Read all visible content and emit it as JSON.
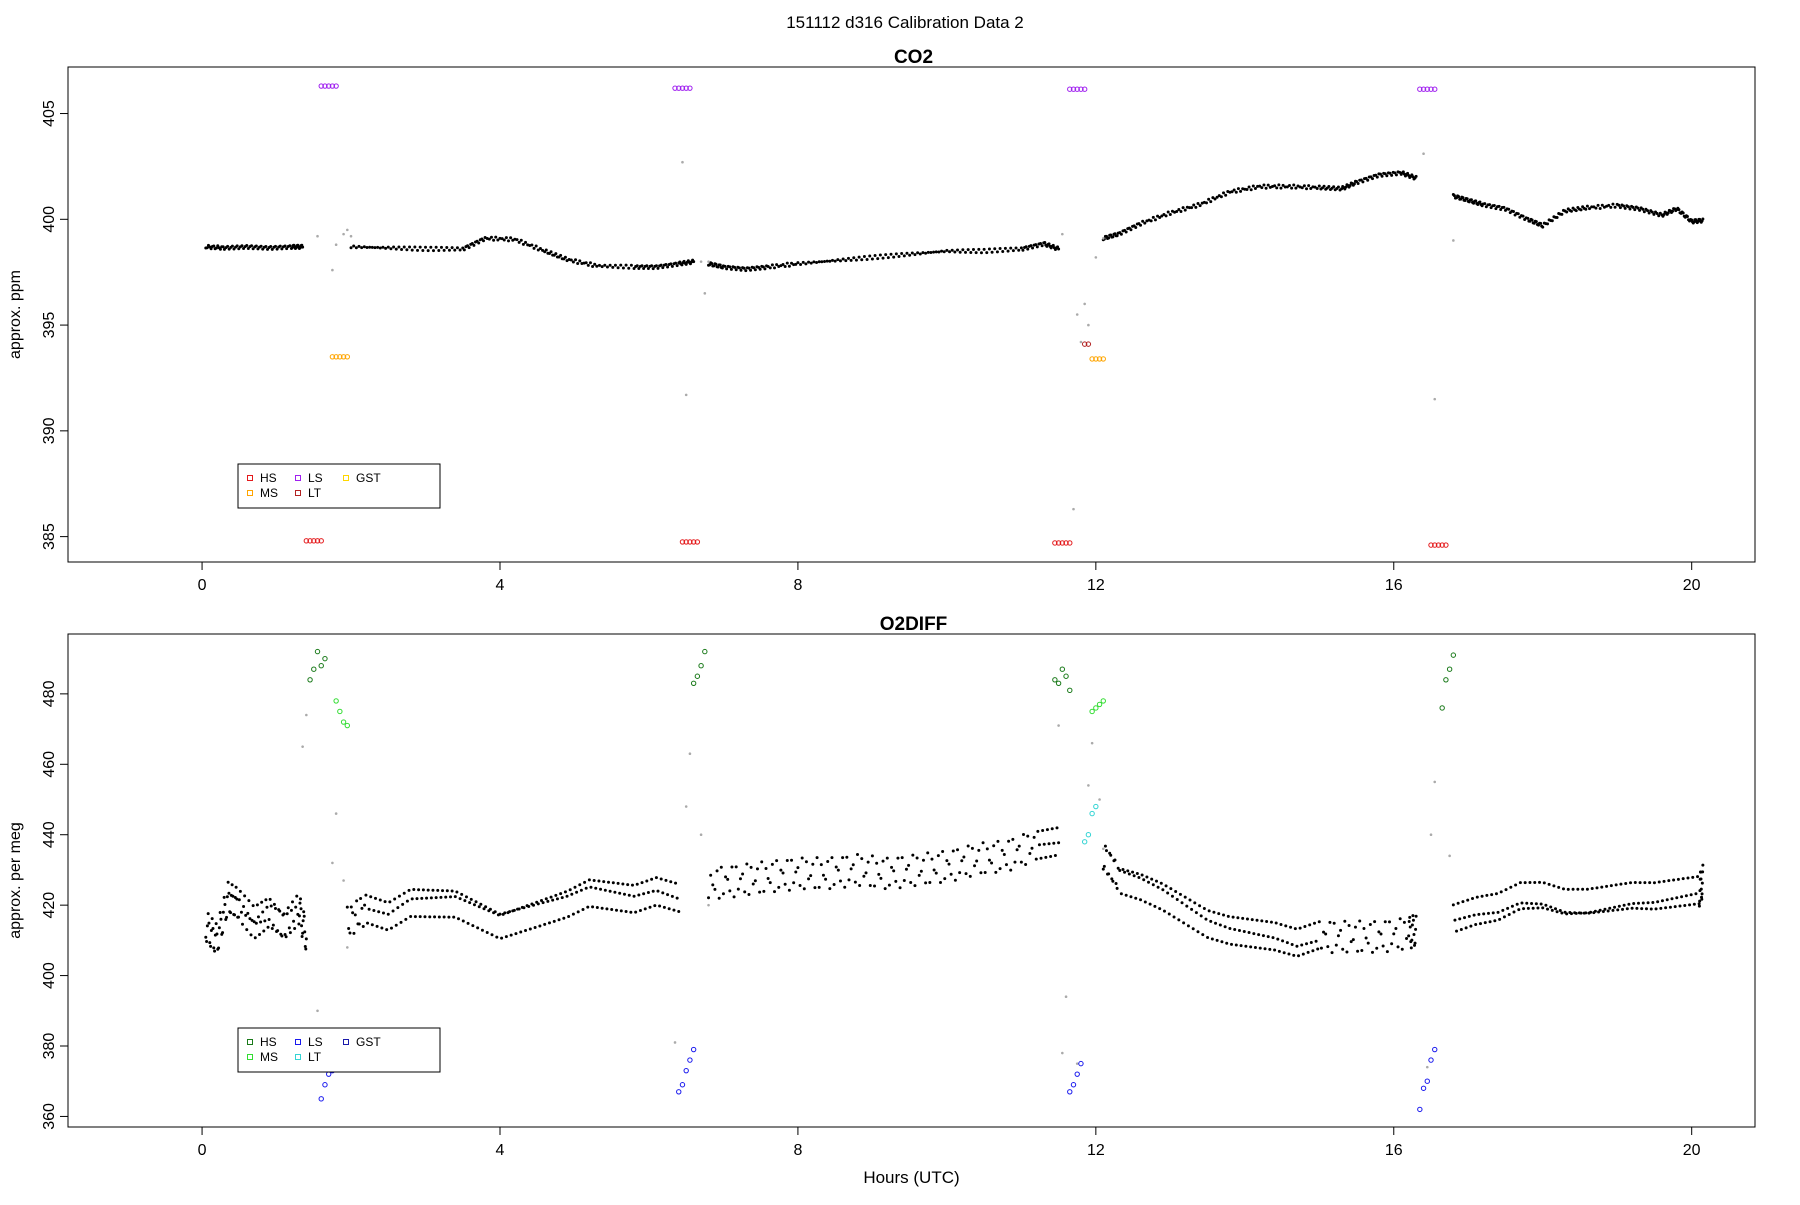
{
  "figure": {
    "title": "151112   d316   Calibration Data 2"
  },
  "chart_data": [
    {
      "type": "scatter",
      "title": "CO2",
      "xlabel": "",
      "ylabel": "approx. ppm",
      "xlim": [
        -1.8,
        20.85
      ],
      "ylim": [
        383.8,
        407.2
      ],
      "xticks": [
        0,
        4,
        8,
        12,
        16,
        20
      ],
      "xtick_labels": [
        "0",
        "4",
        "8",
        "12",
        "16",
        "20"
      ],
      "yticks": [
        385,
        390,
        395,
        400,
        405
      ],
      "ytick_labels": [
        "385",
        "390",
        "395",
        "400",
        "405"
      ],
      "grid": false,
      "legend": {
        "placement": "bottom-left",
        "entries": [
          {
            "name": "HS",
            "color": "#e41a1c"
          },
          {
            "name": "MS",
            "color": "#ffa500"
          },
          {
            "name": "LS",
            "color": "#a020f0"
          },
          {
            "name": "LT",
            "color": "#b22222"
          },
          {
            "name": "GST",
            "color": "#ffd700"
          }
        ]
      },
      "ambient": {
        "color": "#000000",
        "segments": [
          {
            "x": [
              0.05,
              0.3,
              0.6,
              0.9,
              1.2,
              1.35
            ],
            "y": [
              398.7,
              398.65,
              398.7,
              398.65,
              398.7,
              398.7
            ]
          },
          {
            "x": [
              2.0,
              2.5,
              3.0,
              3.5,
              3.8,
              4.2,
              4.6,
              4.9,
              5.3,
              5.8,
              6.1,
              6.4,
              6.6
            ],
            "y": [
              398.7,
              398.65,
              398.6,
              398.6,
              399.1,
              399.05,
              398.5,
              398.1,
              397.8,
              397.75,
              397.75,
              397.9,
              398.0
            ]
          },
          {
            "x": [
              6.8,
              7.0,
              7.3,
              7.6,
              8.0,
              8.5,
              9.0,
              9.5,
              10.0,
              10.5,
              11.0,
              11.3,
              11.5
            ],
            "y": [
              397.9,
              397.75,
              397.65,
              397.75,
              397.9,
              398.05,
              398.2,
              398.35,
              398.5,
              398.5,
              398.6,
              398.85,
              398.6
            ]
          },
          {
            "x": [
              12.1,
              12.3,
              12.6,
              13.0,
              13.4,
              13.8,
              14.2,
              14.6,
              15.0,
              15.3,
              15.5,
              15.8,
              16.1,
              16.3
            ],
            "y": [
              399.1,
              399.3,
              399.8,
              400.3,
              400.7,
              401.3,
              401.55,
              401.55,
              401.5,
              401.45,
              401.75,
              402.1,
              402.2,
              401.95
            ]
          },
          {
            "x": [
              16.8,
              17.0,
              17.2,
              17.5,
              17.8,
              18.0,
              18.3,
              18.6,
              19.0,
              19.3,
              19.6,
              19.8,
              20.0,
              20.15
            ],
            "y": [
              401.1,
              400.9,
              400.7,
              400.5,
              400.0,
              399.7,
              400.4,
              400.55,
              400.65,
              400.5,
              400.2,
              400.5,
              399.9,
              399.95
            ]
          }
        ]
      },
      "transitions": {
        "color": "#aaaaaa",
        "x": [
          1.55,
          1.75,
          1.8,
          1.9,
          1.95,
          2.0,
          6.45,
          6.5,
          6.7,
          6.75,
          6.8,
          11.55,
          11.7,
          11.75,
          11.8,
          11.85,
          11.9,
          12.0,
          12.1,
          16.4,
          16.55,
          16.8
        ],
        "y": [
          399.2,
          397.6,
          398.8,
          399.3,
          399.5,
          399.2,
          402.7,
          391.7,
          398.0,
          396.5,
          398.0,
          399.3,
          386.3,
          395.5,
          394.2,
          396.0,
          395.0,
          398.2,
          399.1,
          403.1,
          391.5,
          399.0
        ]
      },
      "calibration_groups": [
        {
          "name": "HS",
          "color": "#e41a1c",
          "x": [
            1.4,
            1.45,
            1.5,
            1.55,
            1.6,
            6.45,
            6.5,
            6.55,
            6.6,
            6.65,
            11.45,
            11.5,
            11.55,
            11.6,
            11.65,
            16.5,
            16.55,
            16.6,
            16.65,
            16.7
          ],
          "y": [
            384.8,
            384.8,
            384.8,
            384.8,
            384.8,
            384.75,
            384.75,
            384.75,
            384.75,
            384.75,
            384.7,
            384.7,
            384.7,
            384.7,
            384.7,
            384.6,
            384.6,
            384.6,
            384.6,
            384.6
          ]
        },
        {
          "name": "MS",
          "color": "#ffa500",
          "x": [
            1.75,
            1.8,
            1.85,
            1.9,
            1.95,
            11.95,
            12.0,
            12.05,
            12.1
          ],
          "y": [
            393.5,
            393.5,
            393.5,
            393.5,
            393.5,
            393.4,
            393.4,
            393.4,
            393.4
          ]
        },
        {
          "name": "LS",
          "color": "#a020f0",
          "x": [
            1.6,
            1.65,
            1.7,
            1.75,
            1.8,
            6.35,
            6.4,
            6.45,
            6.5,
            6.55,
            11.65,
            11.7,
            11.75,
            11.8,
            11.85,
            16.35,
            16.4,
            16.45,
            16.5,
            16.55
          ],
          "y": [
            406.3,
            406.3,
            406.3,
            406.3,
            406.3,
            406.2,
            406.2,
            406.2,
            406.2,
            406.2,
            406.15,
            406.15,
            406.15,
            406.15,
            406.15,
            406.15,
            406.15,
            406.15,
            406.15,
            406.15
          ]
        },
        {
          "name": "LT",
          "color": "#b22222",
          "x": [
            11.85,
            11.9
          ],
          "y": [
            394.1,
            394.1
          ]
        }
      ]
    },
    {
      "type": "scatter",
      "title": "O2DIFF",
      "xlabel": "Hours (UTC)",
      "ylabel": "approx. per meg",
      "xlim": [
        -1.8,
        20.85
      ],
      "ylim": [
        357,
        497
      ],
      "xticks": [
        0,
        4,
        8,
        12,
        16,
        20
      ],
      "xtick_labels": [
        "0",
        "4",
        "8",
        "12",
        "16",
        "20"
      ],
      "yticks": [
        360,
        380,
        400,
        420,
        440,
        460,
        480
      ],
      "ytick_labels": [
        "360",
        "380",
        "400",
        "420",
        "440",
        "460",
        "480"
      ],
      "grid": false,
      "legend": {
        "placement": "bottom-left",
        "entries": [
          {
            "name": "HS",
            "color": "#1a7a1a"
          },
          {
            "name": "MS",
            "color": "#33dd33"
          },
          {
            "name": "LS",
            "color": "#1a1aee"
          },
          {
            "name": "LT",
            "color": "#33d4d4"
          },
          {
            "name": "GST",
            "color": "#1a1aaa"
          }
        ]
      },
      "ambient": {
        "color": "#000000",
        "segments": [
          {
            "x": [
              0.05,
              0.2,
              0.35,
              0.5,
              0.7,
              0.9,
              1.1,
              1.3,
              1.4
            ],
            "y": [
              414,
              410,
              422,
              420,
              415,
              418,
              414,
              419,
              411
            ]
          },
          {
            "x": [
              1.95,
              2.2,
              2.5,
              2.8,
              3.1,
              3.4,
              3.7,
              4.0,
              4.3,
              4.6,
              4.9,
              5.2,
              5.5,
              5.8,
              6.1,
              6.4
            ],
            "y": [
              415,
              419,
              417,
              421,
              421,
              421,
              418,
              415,
              417,
              419,
              421,
              424,
              423,
              422,
              424,
              422
            ]
          },
          {
            "x": [
              6.8,
              7.2,
              7.6,
              8.0,
              8.4,
              8.8,
              9.2,
              9.6,
              10.0,
              10.4,
              10.8,
              11.2,
              11.5
            ],
            "y": [
              426,
              427,
              428,
              429,
              429,
              430,
              429,
              430,
              431,
              433,
              434,
              437,
              438
            ]
          },
          {
            "x": [
              12.1,
              12.3,
              12.6,
              12.9,
              13.2,
              13.5,
              13.8,
              14.1,
              14.4,
              14.7,
              15.0,
              15.4,
              15.8,
              16.2,
              16.3
            ],
            "y": [
              434,
              428,
              426,
              423,
              419,
              415,
              413,
              412,
              411,
              409,
              411,
              411,
              411,
              412,
              413
            ]
          },
          {
            "x": [
              16.8,
              17.1,
              17.4,
              17.7,
              18.0,
              18.3,
              18.6,
              18.9,
              19.2,
              19.5,
              19.8,
              20.1,
              20.15
            ],
            "y": [
              416,
              418,
              419,
              422,
              422,
              420,
              420,
              421,
              422,
              422,
              423,
              424,
              427
            ]
          }
        ]
      },
      "transitions": {
        "color": "#aaaaaa",
        "x": [
          1.35,
          1.4,
          1.55,
          1.75,
          1.8,
          1.9,
          1.95,
          6.35,
          6.5,
          6.55,
          6.7,
          6.8,
          11.5,
          11.55,
          11.6,
          11.75,
          11.9,
          11.95,
          12.05,
          12.1,
          16.45,
          16.5,
          16.55,
          16.75
        ],
        "y": [
          465,
          474,
          390,
          432,
          446,
          427,
          408,
          381,
          448,
          463,
          440,
          420,
          471,
          378,
          394,
          375,
          454,
          466,
          450,
          436,
          374,
          440,
          455,
          434
        ]
      },
      "calibration_groups": [
        {
          "name": "HS",
          "color": "#1a7a1a",
          "x": [
            1.45,
            1.5,
            1.55,
            1.6,
            1.65,
            6.6,
            6.65,
            6.7,
            6.75,
            11.45,
            11.5,
            11.55,
            11.6,
            11.65,
            16.65,
            16.7,
            16.75,
            16.8
          ],
          "y": [
            484,
            487,
            492,
            488,
            490,
            483,
            485,
            488,
            492,
            484,
            483,
            487,
            485,
            481,
            476,
            484,
            487,
            491
          ]
        },
        {
          "name": "MS",
          "color": "#33dd33",
          "x": [
            1.8,
            1.85,
            1.9,
            1.95,
            11.95,
            12.0,
            12.05,
            12.1
          ],
          "y": [
            478,
            475,
            472,
            471,
            475,
            476,
            477,
            478
          ]
        },
        {
          "name": "LS",
          "color": "#1a1aee",
          "x": [
            1.6,
            1.65,
            1.7,
            1.75,
            6.4,
            6.45,
            6.5,
            6.55,
            6.6,
            11.65,
            11.7,
            11.75,
            11.8,
            16.35,
            16.4,
            16.45,
            16.5,
            16.55
          ],
          "y": [
            365,
            369,
            372,
            373,
            367,
            369,
            373,
            376,
            379,
            367,
            369,
            372,
            375,
            362,
            368,
            370,
            376,
            379
          ]
        },
        {
          "name": "LT",
          "color": "#33d4d4",
          "x": [
            11.85,
            11.9,
            11.95,
            12.0
          ],
          "y": [
            438,
            440,
            446,
            448
          ]
        }
      ]
    }
  ]
}
